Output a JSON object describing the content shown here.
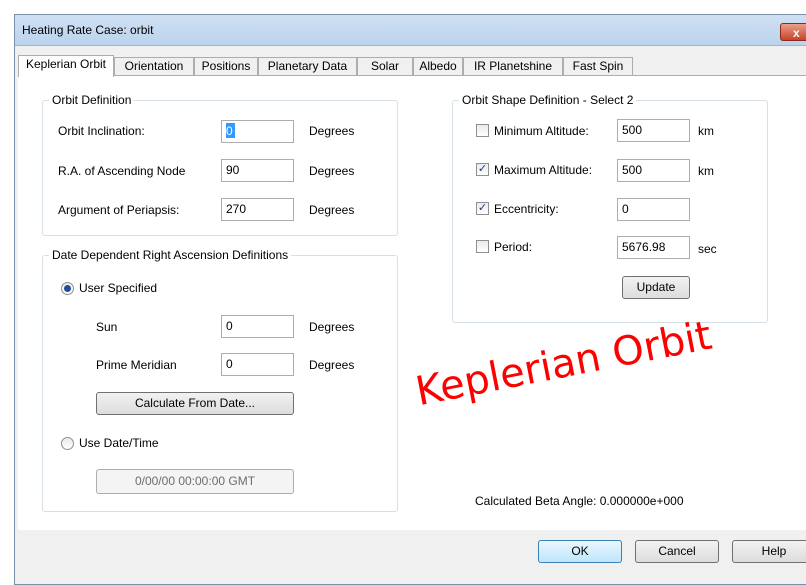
{
  "window": {
    "title": "Heating Rate Case: orbit",
    "close_label": "x"
  },
  "tabs": [
    {
      "label": "Keplerian Orbit"
    },
    {
      "label": "Orientation"
    },
    {
      "label": "Positions"
    },
    {
      "label": "Planetary Data"
    },
    {
      "label": "Solar"
    },
    {
      "label": "Albedo"
    },
    {
      "label": "IR Planetshine"
    },
    {
      "label": "Fast Spin"
    }
  ],
  "orbit_definition": {
    "title": "Orbit Definition",
    "inclination": {
      "label": "Orbit Inclination:",
      "value": "0",
      "unit": "Degrees"
    },
    "raan": {
      "label": "R.A. of Ascending Node",
      "value": "90",
      "unit": "Degrees"
    },
    "periapsis": {
      "label": "Argument of Periapsis:",
      "value": "270",
      "unit": "Degrees"
    }
  },
  "date_ra": {
    "title": "Date Dependent Right Ascension Definitions",
    "user_specified_label": "User Specified",
    "sun": {
      "label": "Sun",
      "value": "0",
      "unit": "Degrees"
    },
    "prime_meridian": {
      "label": "Prime Meridian",
      "value": "0",
      "unit": "Degrees"
    },
    "calculate_button": "Calculate From Date...",
    "use_datetime_label": "Use Date/Time",
    "datetime_value": "0/00/00 00:00:00 GMT"
  },
  "orbit_shape": {
    "title": "Orbit Shape Definition - Select 2",
    "min_altitude": {
      "label": "Minimum Altitude:",
      "value": "500",
      "unit": "km",
      "checked": false
    },
    "max_altitude": {
      "label": "Maximum Altitude:",
      "value": "500",
      "unit": "km",
      "checked": true
    },
    "eccentricity": {
      "label": "Eccentricity:",
      "value": "0",
      "checked": true
    },
    "period": {
      "label": "Period:",
      "value": "5676.98",
      "unit": "sec",
      "checked": false
    },
    "update_button": "Update"
  },
  "beta_angle": "Calculated Beta Angle: 0.000000e+000",
  "overlay_caption": "Keplerian Orbit",
  "footer": {
    "ok": "OK",
    "cancel": "Cancel",
    "help": "Help"
  },
  "colors": {
    "overlay": "#ff0000",
    "titlebar": "#bcd3ee",
    "close": "#c7432c"
  }
}
